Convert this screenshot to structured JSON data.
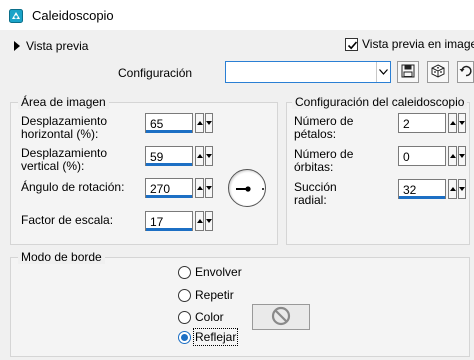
{
  "window": {
    "title": "Caleidoscopio",
    "icon": "kaleidoscope-app-icon",
    "accent_color": "#1c6fc4"
  },
  "toolbar": {
    "preview_toggle_label": "Vista previa",
    "preview_in_image_label": "Vista previa en imagen",
    "preview_in_image_checked": true,
    "config_label": "Configuración",
    "config_value": "",
    "buttons": [
      "save-icon",
      "randomize-icon",
      "reset-icon"
    ]
  },
  "image_area": {
    "title": "Área de imagen",
    "h_offset": {
      "label_line1": "Desplazamiento",
      "label_line2": "horizontal (%):",
      "value": "65"
    },
    "v_offset": {
      "label_line1": "Desplazamiento",
      "label_line2": "vertical (%):",
      "value": "59"
    },
    "rotation": {
      "label": "Ángulo de rotación:",
      "value": "270"
    },
    "scale": {
      "label": "Factor de escala:",
      "value": "17"
    }
  },
  "kaleido_config": {
    "title": "Configuración del caleidoscopio",
    "petals": {
      "label_line1": "Número de",
      "label_line2": "pétalos:",
      "value": "2"
    },
    "orbits": {
      "label_line1": "Número de",
      "label_line2": "órbitas:",
      "value": "0"
    },
    "suction": {
      "label_line1": "Succión",
      "label_line2": "radial:",
      "value": "32"
    }
  },
  "edge_mode": {
    "title": "Modo de borde",
    "options": [
      {
        "label": "Envolver",
        "selected": false
      },
      {
        "label": "Repetir",
        "selected": false
      },
      {
        "label": "Color",
        "selected": false
      },
      {
        "label": "Reflejar",
        "selected": true
      }
    ],
    "color_swatch_icon": "no-color-icon"
  }
}
